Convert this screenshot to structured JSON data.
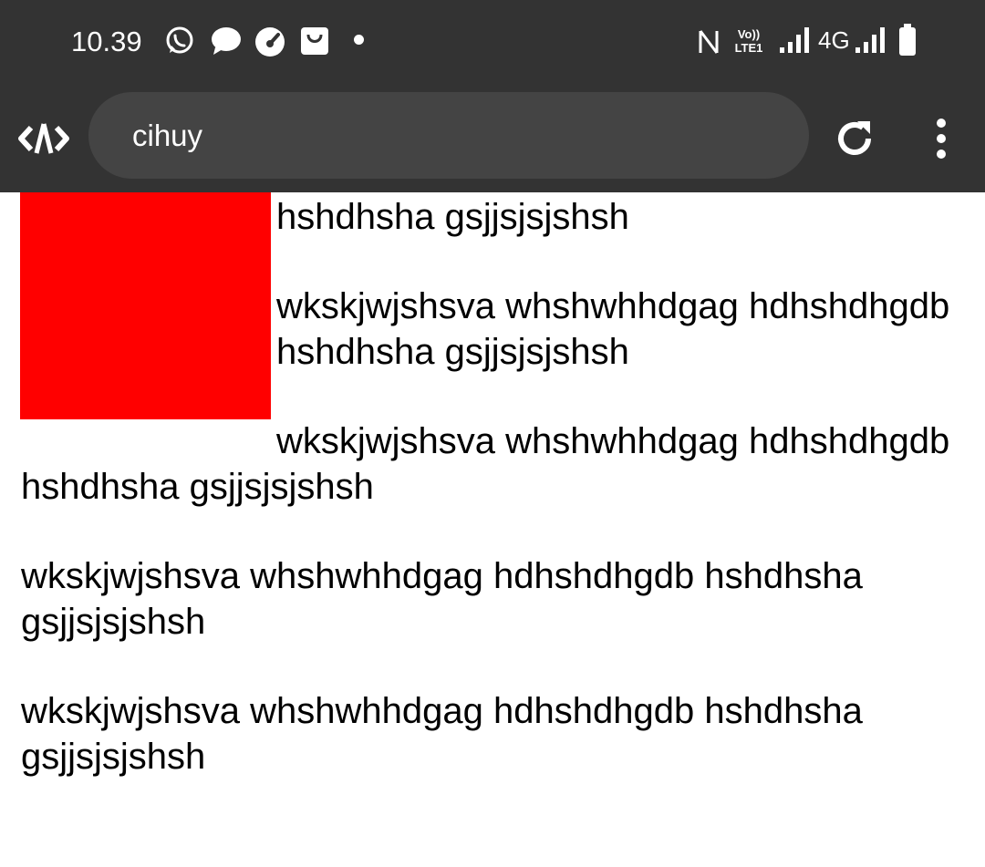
{
  "status_bar": {
    "time": "10.39",
    "network": "4G",
    "lte_label": "LTE1",
    "volte_label": "Vo))"
  },
  "toolbar": {
    "url_text": "cihuy"
  },
  "content": {
    "paragraphs": [
      "wkskjwjshsva whshwhhdgag hdhshdhgdb hshdhsha gsjjsjsjshsh",
      "wkskjwjshsva whshwhhdgag hdhshdhgdb hshdhsha gsjjsjsjshsh",
      "wkskjwjshsva whshwhhdgag hdhshdhgdb hshdhsha gsjjsjsjshsh",
      "wkskjwjshsva whshwhhdgag hdhshdhgdb hshdhsha gsjjsjsjshsh",
      "wkskjwjshsva whshwhhdgag hdhshdhgdb hshdhsha gsjjsjsjshsh"
    ],
    "box_color": "#ff0000"
  },
  "icons": {
    "status": [
      "whatsapp-icon",
      "chat-bubble-icon",
      "speedometer-icon",
      "shopping-bag-icon",
      "notification-dot-icon",
      "nfc-icon",
      "volte-icon",
      "signal-icon",
      "signal-icon",
      "battery-icon"
    ],
    "toolbar": [
      "app-logo-icon",
      "reload-icon",
      "more-vert-icon"
    ]
  },
  "colors": {
    "bar_background": "#333333",
    "url_bar_background": "#444444",
    "text": "#000000"
  }
}
